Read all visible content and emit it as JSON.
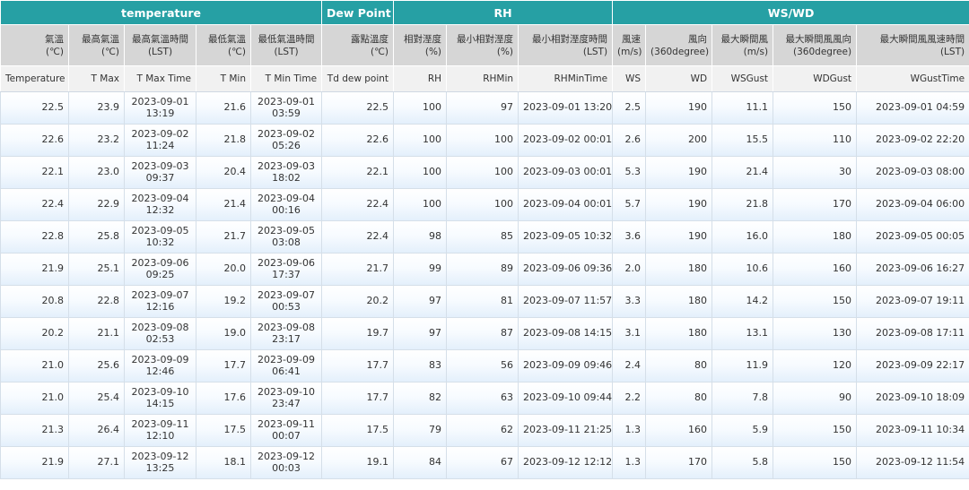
{
  "header": {
    "groups": [
      "temperature",
      "Dew Point",
      "RH",
      "WS/WD"
    ],
    "cn": [
      [
        "氣溫",
        "(℃)"
      ],
      [
        "最高氣溫",
        "(℃)"
      ],
      [
        "最高氣溫時間",
        "(LST)"
      ],
      [
        "最低氣溫",
        "(℃)"
      ],
      [
        "最低氣溫時間",
        "(LST)"
      ],
      [
        "露點溫度",
        "(℃)"
      ],
      [
        "相對溼度",
        "(%)"
      ],
      [
        "最小相對溼度",
        "(%)"
      ],
      [
        "最小相對溼度時間",
        "(LST)"
      ],
      [
        "風速",
        "(m/s)"
      ],
      [
        "風向",
        "(360degree)"
      ],
      [
        "最大瞬間風",
        "(m/s)"
      ],
      [
        "最大瞬間風風向",
        "(360degree)"
      ],
      [
        "最大瞬間風風速時間",
        "(LST)"
      ]
    ],
    "en": [
      "Temperature",
      "T Max",
      "T Max Time",
      "T Min",
      "T Min Time",
      "Td dew point",
      "RH",
      "RHMin",
      "RHMinTime",
      "WS",
      "WD",
      "WSGust",
      "WDGust",
      "WGustTime"
    ]
  },
  "rows": [
    {
      "temp": "22.5",
      "tmax": "23.9",
      "tmax_date": "2023-09-01",
      "tmax_time": "13:19",
      "tmin": "21.6",
      "tmin_date": "2023-09-01",
      "tmin_time": "03:59",
      "td": "22.5",
      "rh": "100",
      "rhmin": "97",
      "rhmin_time": "2023-09-01 13:20",
      "ws": "2.5",
      "wd": "190",
      "wsgust": "11.1",
      "wdgust": "150",
      "wgust_time": "2023-09-01 04:59"
    },
    {
      "temp": "22.6",
      "tmax": "23.2",
      "tmax_date": "2023-09-02",
      "tmax_time": "11:24",
      "tmin": "21.8",
      "tmin_date": "2023-09-02",
      "tmin_time": "05:26",
      "td": "22.6",
      "rh": "100",
      "rhmin": "100",
      "rhmin_time": "2023-09-02 00:01",
      "ws": "2.6",
      "wd": "200",
      "wsgust": "15.5",
      "wdgust": "110",
      "wgust_time": "2023-09-02 22:20"
    },
    {
      "temp": "22.1",
      "tmax": "23.0",
      "tmax_date": "2023-09-03",
      "tmax_time": "09:37",
      "tmin": "20.4",
      "tmin_date": "2023-09-03",
      "tmin_time": "18:02",
      "td": "22.1",
      "rh": "100",
      "rhmin": "100",
      "rhmin_time": "2023-09-03 00:01",
      "ws": "5.3",
      "wd": "190",
      "wsgust": "21.4",
      "wdgust": "30",
      "wgust_time": "2023-09-03 08:00"
    },
    {
      "temp": "22.4",
      "tmax": "22.9",
      "tmax_date": "2023-09-04",
      "tmax_time": "12:32",
      "tmin": "21.4",
      "tmin_date": "2023-09-04",
      "tmin_time": "00:16",
      "td": "22.4",
      "rh": "100",
      "rhmin": "100",
      "rhmin_time": "2023-09-04 00:01",
      "ws": "5.7",
      "wd": "190",
      "wsgust": "21.8",
      "wdgust": "170",
      "wgust_time": "2023-09-04 06:00"
    },
    {
      "temp": "22.8",
      "tmax": "25.8",
      "tmax_date": "2023-09-05",
      "tmax_time": "10:32",
      "tmin": "21.7",
      "tmin_date": "2023-09-05",
      "tmin_time": "03:08",
      "td": "22.4",
      "rh": "98",
      "rhmin": "85",
      "rhmin_time": "2023-09-05 10:32",
      "ws": "3.6",
      "wd": "190",
      "wsgust": "16.0",
      "wdgust": "180",
      "wgust_time": "2023-09-05 00:05"
    },
    {
      "temp": "21.9",
      "tmax": "25.1",
      "tmax_date": "2023-09-06",
      "tmax_time": "09:25",
      "tmin": "20.0",
      "tmin_date": "2023-09-06",
      "tmin_time": "17:37",
      "td": "21.7",
      "rh": "99",
      "rhmin": "89",
      "rhmin_time": "2023-09-06 09:36",
      "ws": "2.0",
      "wd": "180",
      "wsgust": "10.6",
      "wdgust": "160",
      "wgust_time": "2023-09-06 16:27"
    },
    {
      "temp": "20.8",
      "tmax": "22.8",
      "tmax_date": "2023-09-07",
      "tmax_time": "12:16",
      "tmin": "19.2",
      "tmin_date": "2023-09-07",
      "tmin_time": "00:53",
      "td": "20.2",
      "rh": "97",
      "rhmin": "81",
      "rhmin_time": "2023-09-07 11:57",
      "ws": "3.3",
      "wd": "180",
      "wsgust": "14.2",
      "wdgust": "150",
      "wgust_time": "2023-09-07 19:11"
    },
    {
      "temp": "20.2",
      "tmax": "21.1",
      "tmax_date": "2023-09-08",
      "tmax_time": "02:53",
      "tmin": "19.0",
      "tmin_date": "2023-09-08",
      "tmin_time": "23:17",
      "td": "19.7",
      "rh": "97",
      "rhmin": "87",
      "rhmin_time": "2023-09-08 14:15",
      "ws": "3.1",
      "wd": "180",
      "wsgust": "13.1",
      "wdgust": "130",
      "wgust_time": "2023-09-08 17:11"
    },
    {
      "temp": "21.0",
      "tmax": "25.6",
      "tmax_date": "2023-09-09",
      "tmax_time": "12:46",
      "tmin": "17.7",
      "tmin_date": "2023-09-09",
      "tmin_time": "06:41",
      "td": "17.7",
      "rh": "83",
      "rhmin": "56",
      "rhmin_time": "2023-09-09 09:46",
      "ws": "2.4",
      "wd": "80",
      "wsgust": "11.9",
      "wdgust": "120",
      "wgust_time": "2023-09-09 22:17"
    },
    {
      "temp": "21.0",
      "tmax": "25.4",
      "tmax_date": "2023-09-10",
      "tmax_time": "14:15",
      "tmin": "17.6",
      "tmin_date": "2023-09-10",
      "tmin_time": "23:47",
      "td": "17.7",
      "rh": "82",
      "rhmin": "63",
      "rhmin_time": "2023-09-10 09:44",
      "ws": "2.2",
      "wd": "80",
      "wsgust": "7.8",
      "wdgust": "90",
      "wgust_time": "2023-09-10 18:09"
    },
    {
      "temp": "21.3",
      "tmax": "26.4",
      "tmax_date": "2023-09-11",
      "tmax_time": "12:10",
      "tmin": "17.5",
      "tmin_date": "2023-09-11",
      "tmin_time": "00:07",
      "td": "17.5",
      "rh": "79",
      "rhmin": "62",
      "rhmin_time": "2023-09-11 21:25",
      "ws": "1.3",
      "wd": "160",
      "wsgust": "5.9",
      "wdgust": "150",
      "wgust_time": "2023-09-11 10:34"
    },
    {
      "temp": "21.9",
      "tmax": "27.1",
      "tmax_date": "2023-09-12",
      "tmax_time": "13:25",
      "tmin": "18.1",
      "tmin_date": "2023-09-12",
      "tmin_time": "00:03",
      "td": "19.1",
      "rh": "84",
      "rhmin": "67",
      "rhmin_time": "2023-09-12 12:12",
      "ws": "1.3",
      "wd": "170",
      "wsgust": "5.8",
      "wdgust": "150",
      "wgust_time": "2023-09-12 11:54"
    }
  ]
}
